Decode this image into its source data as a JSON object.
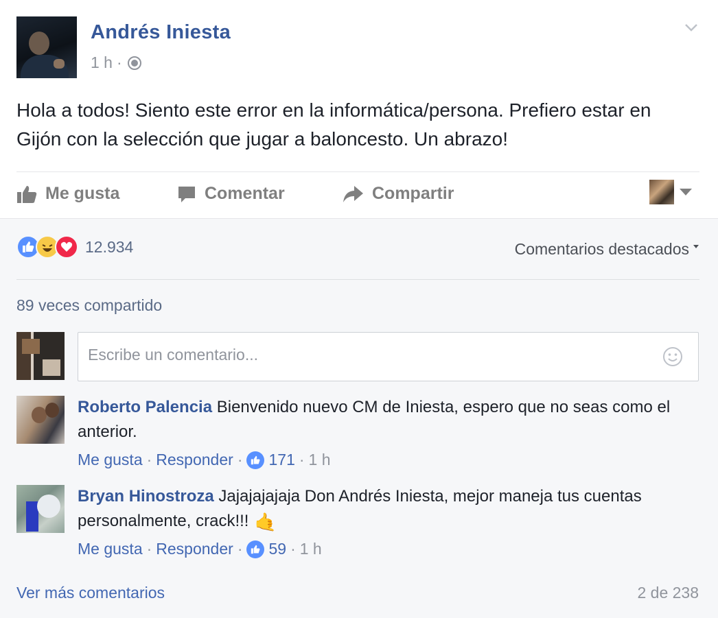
{
  "post": {
    "author": "Andrés Iniesta",
    "time": "1 h",
    "meta_separator": "·",
    "audience_icon": "globe-icon",
    "text": "Hola a todos! Siento este error en la informática/persona. Prefiero estar en Gijón con la selección que jugar a baloncesto. Un abrazo!"
  },
  "actions": {
    "like": "Me gusta",
    "comment": "Comentar",
    "share": "Compartir"
  },
  "stats": {
    "reaction_icons": [
      "like-reaction-icon",
      "haha-reaction-icon",
      "love-reaction-icon"
    ],
    "reaction_count": "12.934",
    "featured_label": "Comentarios destacados",
    "shares": "89 veces compartido"
  },
  "composer": {
    "placeholder": "Escribe un comentario..."
  },
  "comments": [
    {
      "author": "Roberto Palencia",
      "text": "Bienvenido nuevo CM de Iniesta, espero que no seas como el anterior.",
      "like_label": "Me gusta",
      "reply_label": "Responder",
      "likes": "171",
      "time": "1 h",
      "separator": "·"
    },
    {
      "author": "Bryan Hinostroza",
      "text": "Jajajajajaja Don Andrés Iniesta, mejor maneja tus cuentas personalmente, crack!!!",
      "emoji": "🤙",
      "like_label": "Me gusta",
      "reply_label": "Responder",
      "likes": "59",
      "time": "1 h",
      "separator": "·"
    }
  ],
  "footer": {
    "more_comments": "Ver más comentarios",
    "count": "2 de 238"
  },
  "colors": {
    "link": "#365899",
    "like_blue": "#5890ff",
    "love_red": "#f0284a",
    "haha_yellow": "#f7c948",
    "muted": "#90949c",
    "comments_bg": "#f6f7f9"
  }
}
